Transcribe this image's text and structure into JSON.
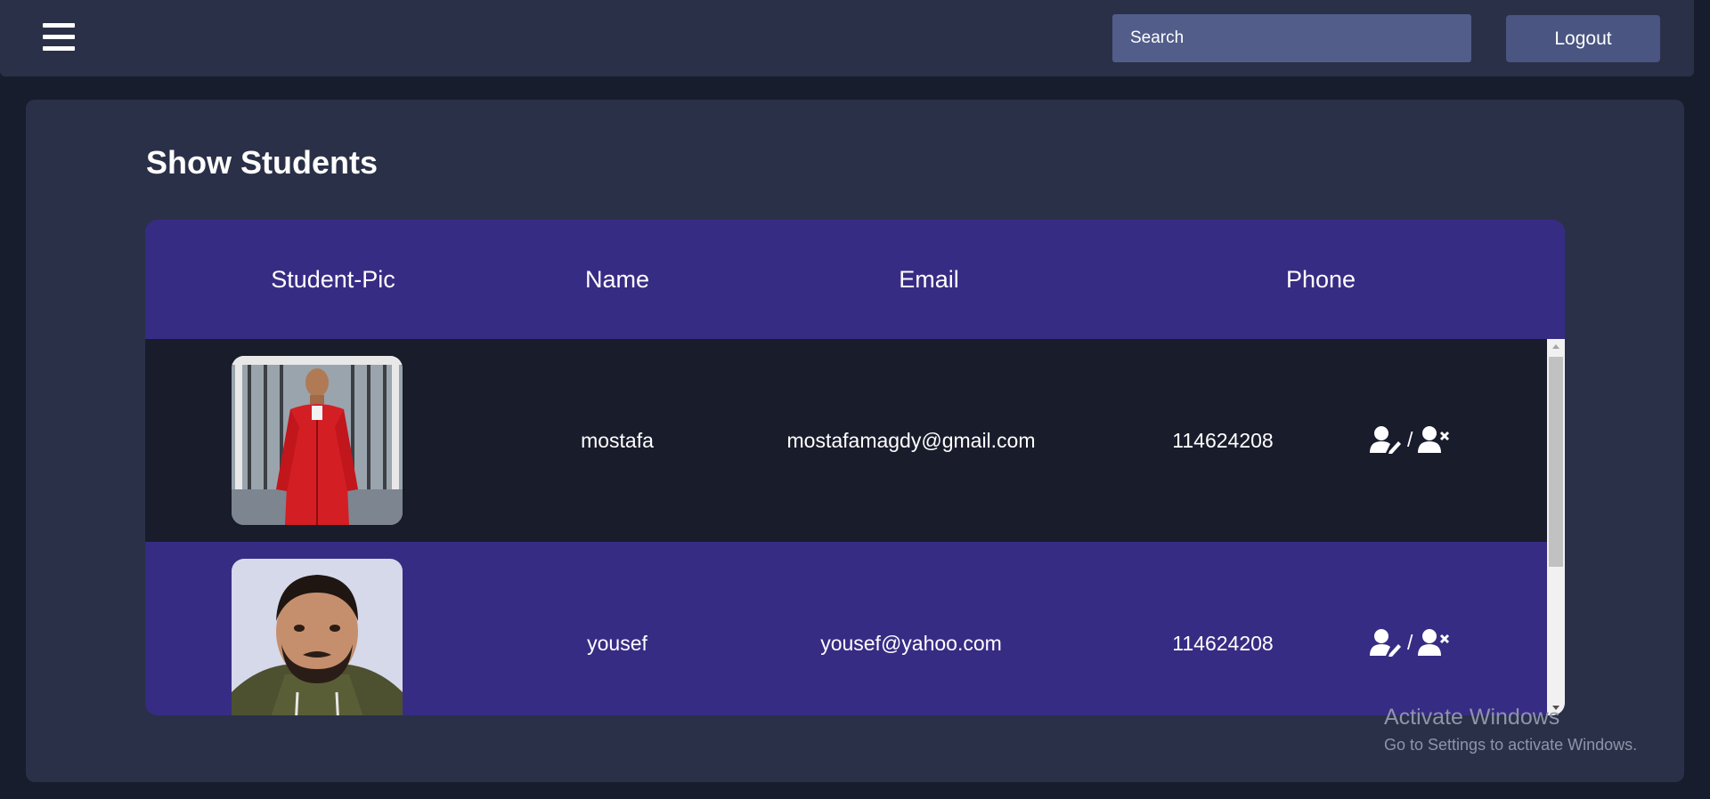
{
  "header": {
    "menu_icon": "hamburger-menu-icon",
    "search_placeholder": "Search",
    "logout_label": "Logout"
  },
  "main": {
    "title": "Show Students",
    "table": {
      "columns": [
        "Student-Pic",
        "Name",
        "Email",
        "Phone"
      ],
      "rows": [
        {
          "name": "mostafa",
          "email": "mostafamagdy@gmail.com",
          "phone": "114624208",
          "separator": "/"
        },
        {
          "name": "yousef",
          "email": "yousef@yahoo.com",
          "phone": "114624208",
          "separator": "/"
        }
      ],
      "action_icons": [
        "user-edit-icon",
        "user-delete-icon"
      ]
    }
  },
  "watermark": {
    "title": "Activate Windows",
    "subtitle": "Go to Settings to activate Windows."
  },
  "colors": {
    "background": "#181d2d",
    "panel": "#2a3047",
    "table_header": "#372c84",
    "row_dark": "#191c2b",
    "search_bg": "#525d8a",
    "button_bg": "#4a5581"
  }
}
